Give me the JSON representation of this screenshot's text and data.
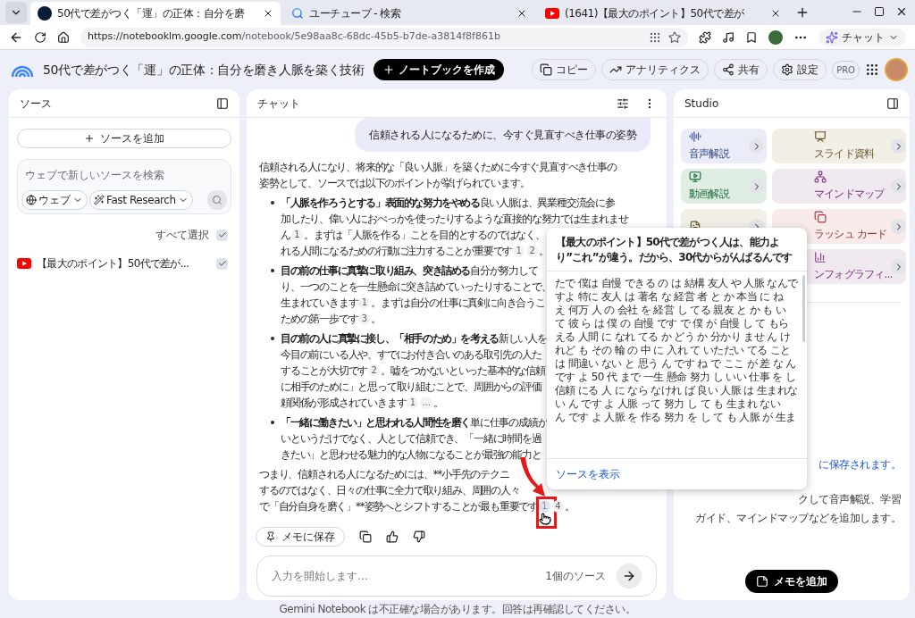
{
  "browser": {
    "tabs": [
      {
        "title": "50代で差がつく「運」の正体：自分を磨",
        "kind": "notebook",
        "selected": true
      },
      {
        "title": "ユーチューブ - 検索",
        "kind": "search",
        "selected": false
      },
      {
        "title": "(1641)【最大のポイント】50代で差が",
        "kind": "youtube",
        "selected": false
      }
    ],
    "url_host": "https://notebooklm.google.com",
    "url_path": "/notebook/5e98aa8c-68dc-45b5-b7de-a3814f8f861b",
    "copilot_label": "チャット"
  },
  "header": {
    "title": "50代で差がつく「運」の正体：自分を磨き人脈を築く技術",
    "create_button": "ノートブックを作成",
    "actions": [
      {
        "label": "コピー",
        "kind": "copy"
      },
      {
        "label": "アナリティクス",
        "kind": "analytics"
      },
      {
        "label": "共有",
        "kind": "share"
      },
      {
        "label": "設定",
        "kind": "settings"
      }
    ],
    "badge": "PRO"
  },
  "sources": {
    "title": "ソース",
    "add_button": "ソースを追加",
    "search_placeholder": "ウェブで新しいソースを検索",
    "web_dropdown": "ウェブ",
    "research_dropdown": "Fast Research",
    "select_all": {
      "label": "すべて選択",
      "checked": true
    },
    "items": [
      {
        "title": "【最大のポイント】50代で差が...",
        "checked": true
      }
    ]
  },
  "chat": {
    "title": "チャット",
    "user_message": "信頼される人になるために、今すぐ見直すべき仕事の姿勢",
    "blocks": [
      {
        "kind": "para",
        "lines": [
          [
            {
              "kind": "text",
              "text": "信頼される人になり、将来的な「良い人脈」を築くために今すぐ見直すべき仕事の"
            }
          ],
          [
            {
              "kind": "text",
              "text": "姿勢として、ソースでは以下のポイントが挙げられています。"
            }
          ]
        ]
      },
      {
        "kind": "bullet",
        "lines": [
          [
            {
              "kind": "bold",
              "text": "「人脈を作ろうとする」表面的な努力をやめる"
            },
            {
              "kind": "text",
              "text": " 良い人脈は、異業種交流会に参"
            }
          ],
          [
            {
              "kind": "text",
              "text": "加したり、偉い人におべっかを使ったりするような直接的な努力では生まれませ"
            }
          ],
          [
            {
              "kind": "text",
              "text": "ん"
            },
            {
              "kind": "cite",
              "text": "1",
              "selected": false
            },
            {
              "kind": "text",
              "text": "。まずは「人脈を作る」ことを目的とするのではなく、"
            }
          ],
          [
            {
              "kind": "text",
              "text": "れる人間になるための行動に注力することが重要です"
            },
            {
              "kind": "cite",
              "text": "1",
              "selected": false
            },
            {
              "kind": "cite",
              "text": "2",
              "selected": false
            },
            {
              "kind": "text",
              "text": "。"
            }
          ]
        ]
      },
      {
        "kind": "bullet",
        "lines": [
          [
            {
              "kind": "bold",
              "text": "目の前の仕事に真摯に取り組み、突き詰める"
            },
            {
              "kind": "text",
              "text": " 自分が努力して"
            }
          ],
          [
            {
              "kind": "text",
              "text": "り、一つのことを一生懸命に突き詰めていったりすることで、"
            }
          ],
          [
            {
              "kind": "text",
              "text": "生まれていきます"
            },
            {
              "kind": "cite",
              "text": "1",
              "selected": false
            },
            {
              "kind": "text",
              "text": "。まずは自分の仕事に真剣に向き合うこ"
            }
          ],
          [
            {
              "kind": "text",
              "text": "ための第一歩です"
            },
            {
              "kind": "cite",
              "text": "3",
              "selected": false
            },
            {
              "kind": "text",
              "text": "。"
            }
          ]
        ]
      },
      {
        "kind": "bullet",
        "lines": [
          [
            {
              "kind": "bold",
              "text": "目の前の人に真摯に接し、「相手のため」を考える"
            },
            {
              "kind": "text",
              "text": " 新しい人を"
            }
          ],
          [
            {
              "kind": "text",
              "text": "今目の前にいる人や、すでにお付き合いのある取引先の人た"
            }
          ],
          [
            {
              "kind": "text",
              "text": "することが大切です"
            },
            {
              "kind": "cite",
              "text": "2",
              "selected": false
            },
            {
              "kind": "text",
              "text": "。嘘をつかないといった基本的な信頼"
            }
          ],
          [
            {
              "kind": "text",
              "text": "に相手のために」と思って取り組むことで、周囲からの評価"
            }
          ],
          [
            {
              "kind": "text",
              "text": "頼関係が形成されていきます"
            },
            {
              "kind": "cite",
              "text": "1",
              "selected": false
            },
            {
              "kind": "cite",
              "text": "...",
              "selected": false
            },
            {
              "kind": "text",
              "text": "。"
            }
          ]
        ]
      },
      {
        "kind": "bullet",
        "lines": [
          [
            {
              "kind": "bold",
              "text": "「一緒に働きたい」と思われる人間性を磨く"
            },
            {
              "kind": "text",
              "text": " 単に仕事の成績が"
            }
          ],
          [
            {
              "kind": "text",
              "text": "いというだけでなく、人として信頼でき、「一緒に時間を過"
            }
          ],
          [
            {
              "kind": "text",
              "text": "きたい」と思わせる魅力的な人物になることが最強の能力と"
            }
          ]
        ]
      },
      {
        "kind": "para",
        "lines": [
          [
            {
              "kind": "text",
              "text": "つまり、信頼される人になるためには、**小手先のテクニ"
            }
          ],
          [
            {
              "kind": "text",
              "text": "するのではなく、日々の仕事に全力で取り組み、周囲の人々"
            }
          ],
          [
            {
              "kind": "text",
              "text": "で「自分自身を磨く」**姿勢へとシフトすることが最も重要です"
            },
            {
              "kind": "cite",
              "text": "1",
              "selected": true
            },
            {
              "kind": "cite",
              "text": "4",
              "selected": false
            },
            {
              "kind": "text",
              "text": "。"
            }
          ]
        ]
      }
    ],
    "save_button": "メモに保存",
    "input_placeholder": "入力を開始します...",
    "source_count": "1個のソース"
  },
  "popup": {
    "title": "【最大のポイント】50代で差がつく人は、能力より”これ”が違う。だから、30代からがんばるんです",
    "body": "たで 僕は 自慢 できる の は 結構 友人 や 人脈 なんですよ 特に 友人 は 著名 な 経営 者 と か 本当 に ねえ 何万 人 の 会社 を 経営 し てる 親友 と か も いて 彼 ら は 僕 の 自慢 です で 僕 が 自慢 し て もらえる 人間 に なれ てる か どう か 分かり ませ ん けれど も その 輪 の 中 に 入れ て いただい てる ことは 間違い ない と 思う ん です ね で ここ が 差 な んです よ 50 代 まで 一生 懸命 努力 し いい 仕事 を し信頼 にる 人 に なら なけれ ば 良い 人脈 は 生まれない ん です よ 人脈 って 努力 し て も 生まれ ないん です よ 人脈 を 作る 努力 を し て も 人脈 が 生ま",
    "link": "ソースを表示"
  },
  "studio": {
    "title": "Studio",
    "tiles": [
      {
        "label": "音声解説",
        "kind": "audio",
        "color": "#eaedf7"
      },
      {
        "label": "スライド資料",
        "kind": "slides",
        "color": "#f1efe6"
      },
      {
        "label": "動画解説",
        "kind": "video",
        "color": "#dfeee3"
      },
      {
        "label": "マインドマップ",
        "kind": "mindmap",
        "color": "#f1e9f0"
      },
      {
        "kind": "report",
        "color": "#f1efe6"
      },
      {
        "label": "ラッシュ カード",
        "kind": "flashcards",
        "color": "#f8ebea"
      },
      {
        "kind": "hidden"
      },
      {
        "label": "ンフォグラフィ...",
        "kind": "infographic",
        "color": "#f1e9f0"
      }
    ],
    "note_lines": [
      {
        "kind": "link",
        "text": "に保存されます。"
      },
      {
        "kind": "text",
        "text": "クして音声解説、学習"
      },
      {
        "kind": "text",
        "text": "ガイド、マインドマップなどを追加します。"
      }
    ],
    "add_note_button": "メモを追加"
  },
  "footer": "Gemini Notebook は不正確な場合があります。回答は再確認してください。"
}
